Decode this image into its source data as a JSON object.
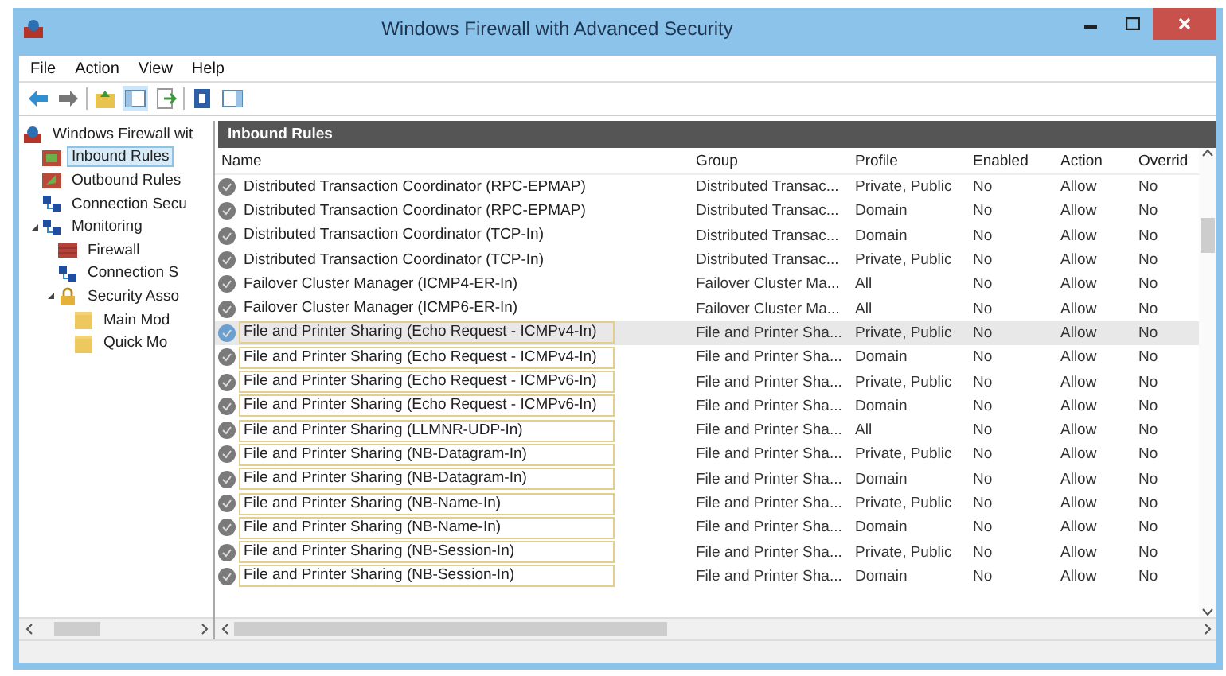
{
  "window": {
    "title": "Windows Firewall with Advanced Security"
  },
  "menu": [
    "File",
    "Action",
    "View",
    "Help"
  ],
  "tree": [
    {
      "label": "Windows Firewall wit",
      "kind": "root",
      "selected": false,
      "children": [
        {
          "label": "Inbound Rules",
          "kind": "inbound",
          "selected": true
        },
        {
          "label": "Outbound Rules",
          "kind": "outbound",
          "selected": false
        },
        {
          "label": "Connection Secu",
          "kind": "connection",
          "selected": false
        },
        {
          "label": "Monitoring",
          "kind": "connection",
          "selected": false,
          "expanded": true,
          "children": [
            {
              "label": "Firewall",
              "kind": "firewall",
              "selected": false
            },
            {
              "label": "Connection S",
              "kind": "connection",
              "selected": false
            },
            {
              "label": "Security Asso",
              "kind": "lock",
              "selected": false,
              "expanded": true,
              "children": [
                {
                  "label": "Main Mod",
                  "kind": "folder",
                  "selected": false
                },
                {
                  "label": "Quick Mo",
                  "kind": "folder",
                  "selected": false
                }
              ]
            }
          ]
        }
      ]
    }
  ],
  "pane_title": "Inbound Rules",
  "table": {
    "columns": [
      "Name",
      "Group",
      "Profile",
      "Enabled",
      "Action",
      "Overrid"
    ],
    "rows": [
      {
        "cells": [
          "Distributed Transaction Coordinator (RPC-EPMAP)",
          "Distributed Transac...",
          "Private, Public",
          "No",
          "Allow",
          "No"
        ],
        "selected": false,
        "outlined": false
      },
      {
        "cells": [
          "Distributed Transaction Coordinator (RPC-EPMAP)",
          "Distributed Transac...",
          "Domain",
          "No",
          "Allow",
          "No"
        ],
        "selected": false,
        "outlined": false
      },
      {
        "cells": [
          "Distributed Transaction Coordinator (TCP-In)",
          "Distributed Transac...",
          "Domain",
          "No",
          "Allow",
          "No"
        ],
        "selected": false,
        "outlined": false
      },
      {
        "cells": [
          "Distributed Transaction Coordinator (TCP-In)",
          "Distributed Transac...",
          "Private, Public",
          "No",
          "Allow",
          "No"
        ],
        "selected": false,
        "outlined": false
      },
      {
        "cells": [
          "Failover Cluster Manager (ICMP4-ER-In)",
          "Failover Cluster Ma...",
          "All",
          "No",
          "Allow",
          "No"
        ],
        "selected": false,
        "outlined": false
      },
      {
        "cells": [
          "Failover Cluster Manager (ICMP6-ER-In)",
          "Failover Cluster Ma...",
          "All",
          "No",
          "Allow",
          "No"
        ],
        "selected": false,
        "outlined": false
      },
      {
        "cells": [
          "File and Printer Sharing (Echo Request - ICMPv4-In)",
          "File and Printer Sha...",
          "Private, Public",
          "No",
          "Allow",
          "No"
        ],
        "selected": true,
        "outlined": true
      },
      {
        "cells": [
          "File and Printer Sharing (Echo Request - ICMPv4-In)",
          "File and Printer Sha...",
          "Domain",
          "No",
          "Allow",
          "No"
        ],
        "selected": false,
        "outlined": true
      },
      {
        "cells": [
          "File and Printer Sharing (Echo Request - ICMPv6-In)",
          "File and Printer Sha...",
          "Private, Public",
          "No",
          "Allow",
          "No"
        ],
        "selected": false,
        "outlined": true
      },
      {
        "cells": [
          "File and Printer Sharing (Echo Request - ICMPv6-In)",
          "File and Printer Sha...",
          "Domain",
          "No",
          "Allow",
          "No"
        ],
        "selected": false,
        "outlined": true
      },
      {
        "cells": [
          "File and Printer Sharing (LLMNR-UDP-In)",
          "File and Printer Sha...",
          "All",
          "No",
          "Allow",
          "No"
        ],
        "selected": false,
        "outlined": true
      },
      {
        "cells": [
          "File and Printer Sharing (NB-Datagram-In)",
          "File and Printer Sha...",
          "Private, Public",
          "No",
          "Allow",
          "No"
        ],
        "selected": false,
        "outlined": true
      },
      {
        "cells": [
          "File and Printer Sharing (NB-Datagram-In)",
          "File and Printer Sha...",
          "Domain",
          "No",
          "Allow",
          "No"
        ],
        "selected": false,
        "outlined": true
      },
      {
        "cells": [
          "File and Printer Sharing (NB-Name-In)",
          "File and Printer Sha...",
          "Private, Public",
          "No",
          "Allow",
          "No"
        ],
        "selected": false,
        "outlined": true
      },
      {
        "cells": [
          "File and Printer Sharing (NB-Name-In)",
          "File and Printer Sha...",
          "Domain",
          "No",
          "Allow",
          "No"
        ],
        "selected": false,
        "outlined": true
      },
      {
        "cells": [
          "File and Printer Sharing (NB-Session-In)",
          "File and Printer Sha...",
          "Private, Public",
          "No",
          "Allow",
          "No"
        ],
        "selected": false,
        "outlined": true
      },
      {
        "cells": [
          "File and Printer Sharing (NB-Session-In)",
          "File and Printer Sha...",
          "Domain",
          "No",
          "Allow",
          "No"
        ],
        "selected": false,
        "outlined": true
      }
    ]
  }
}
